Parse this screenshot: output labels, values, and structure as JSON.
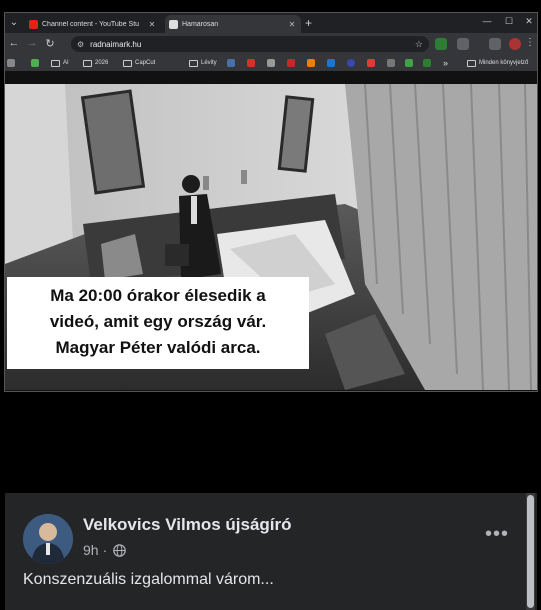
{
  "browser": {
    "tabs": [
      {
        "label": "Channel content - YouTube Stu",
        "icon": "youtube-icon",
        "active": false
      },
      {
        "label": "Hamarosan",
        "icon": "site-logo-icon",
        "active": true
      }
    ],
    "new_tab_label": "+",
    "url": "radnaimark.hu",
    "bookmarks": [
      {
        "label": "AI",
        "icon": "folder-icon"
      },
      {
        "label": "2026",
        "icon": "folder-icon"
      },
      {
        "label": "CapCut",
        "icon": "folder-icon"
      },
      {
        "label": "Lévity",
        "icon": "folder-icon"
      }
    ],
    "bookmarks_overflow": "»",
    "other_bookmarks": "Minden könyvjelző"
  },
  "video": {
    "caption_lines": [
      "Ma 20:00 órakor élesedik a",
      "videó, amit egy ország vár.",
      "Magyar Péter valódi arca."
    ]
  },
  "post": {
    "author": "Velkovics Vilmos újságíró",
    "time": "9h",
    "separator": "·",
    "text": "Konszenzuális izgalommal várom..."
  },
  "colors": {
    "browser_dark": "#202124",
    "browser_toolbar": "#35363a",
    "fb_card": "#242526",
    "fb_text": "#e4e6eb",
    "fb_secondary": "#b0b3b8"
  }
}
